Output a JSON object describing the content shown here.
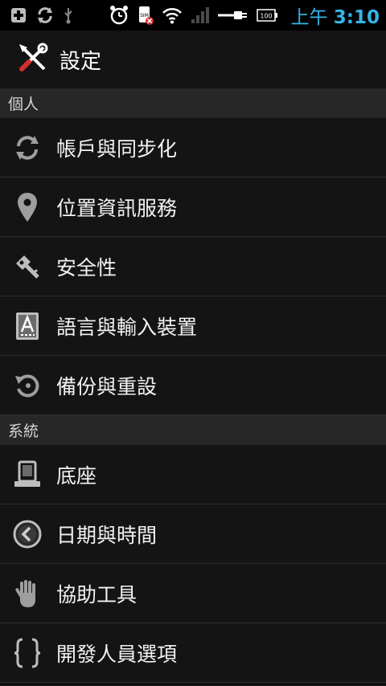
{
  "status_bar": {
    "time_prefix": "上午",
    "time": "3:10",
    "battery": "100",
    "sim_label": "SIM",
    "icons": [
      "plus-icon",
      "sync-icon",
      "usb-icon",
      "alarm-icon",
      "sim-error-icon",
      "wifi-icon",
      "signal-icon",
      "charging-icon",
      "battery-icon"
    ],
    "accent_color": "#33b5e5"
  },
  "action_bar": {
    "title": "設定",
    "icon": "settings-tools-icon"
  },
  "sections": [
    {
      "header": "個人",
      "items": [
        {
          "label": "帳戶與同步化",
          "icon": "sync-icon"
        },
        {
          "label": "位置資訊服務",
          "icon": "location-pin-icon"
        },
        {
          "label": "安全性",
          "icon": "key-icon"
        },
        {
          "label": "語言與輸入裝置",
          "icon": "keyboard-a-icon"
        },
        {
          "label": "備份與重設",
          "icon": "backup-restore-icon"
        }
      ]
    },
    {
      "header": "系統",
      "items": [
        {
          "label": "底座",
          "icon": "dock-icon"
        },
        {
          "label": "日期與時間",
          "icon": "clock-icon"
        },
        {
          "label": "協助工具",
          "icon": "hand-icon"
        },
        {
          "label": "開發人員選項",
          "icon": "braces-icon"
        }
      ]
    }
  ]
}
